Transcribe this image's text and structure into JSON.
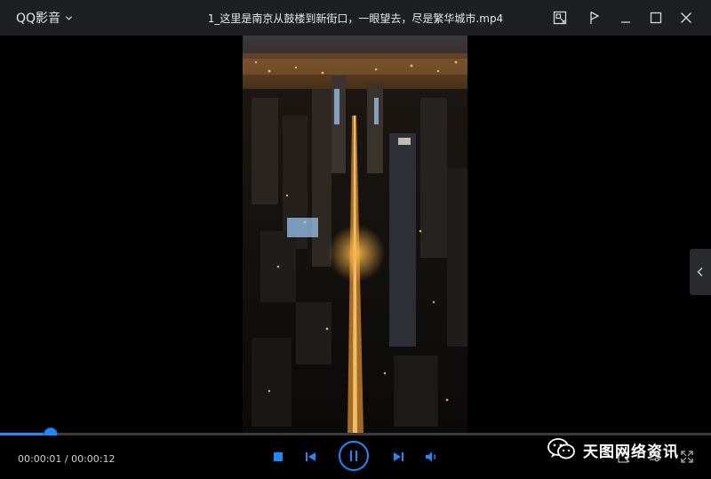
{
  "titlebar": {
    "app_name": "QQ影音",
    "file_title": "1_这里是南京从鼓楼到新街口，一眼望去，尽是繁华城市.mp4"
  },
  "icons": {
    "app_menu": "chevron-down-icon",
    "screenshot": "screenshot-icon",
    "pin": "pin-icon",
    "minimize": "minimize-icon",
    "maximize": "maximize-icon",
    "close": "close-icon",
    "side_panel": "chevron-left-icon",
    "stop": "stop-icon",
    "previous": "previous-icon",
    "pause": "pause-icon",
    "next": "next-icon",
    "volume": "volume-icon",
    "watermark": "wechat-icon",
    "toolbox": "toolbox-icon",
    "settings": "settings-icon",
    "fullscreen": "fullscreen-icon"
  },
  "playback": {
    "current_time": "00:00:01",
    "total_time": "00:00:12",
    "time_display": "00:00:01 / 00:00:12",
    "progress_fraction": 0.07
  },
  "watermark": {
    "text": "天图网络资讯"
  },
  "colors": {
    "accent": "#1a8cff",
    "titlebar_bg": "#1e1f22",
    "background": "#000000"
  }
}
